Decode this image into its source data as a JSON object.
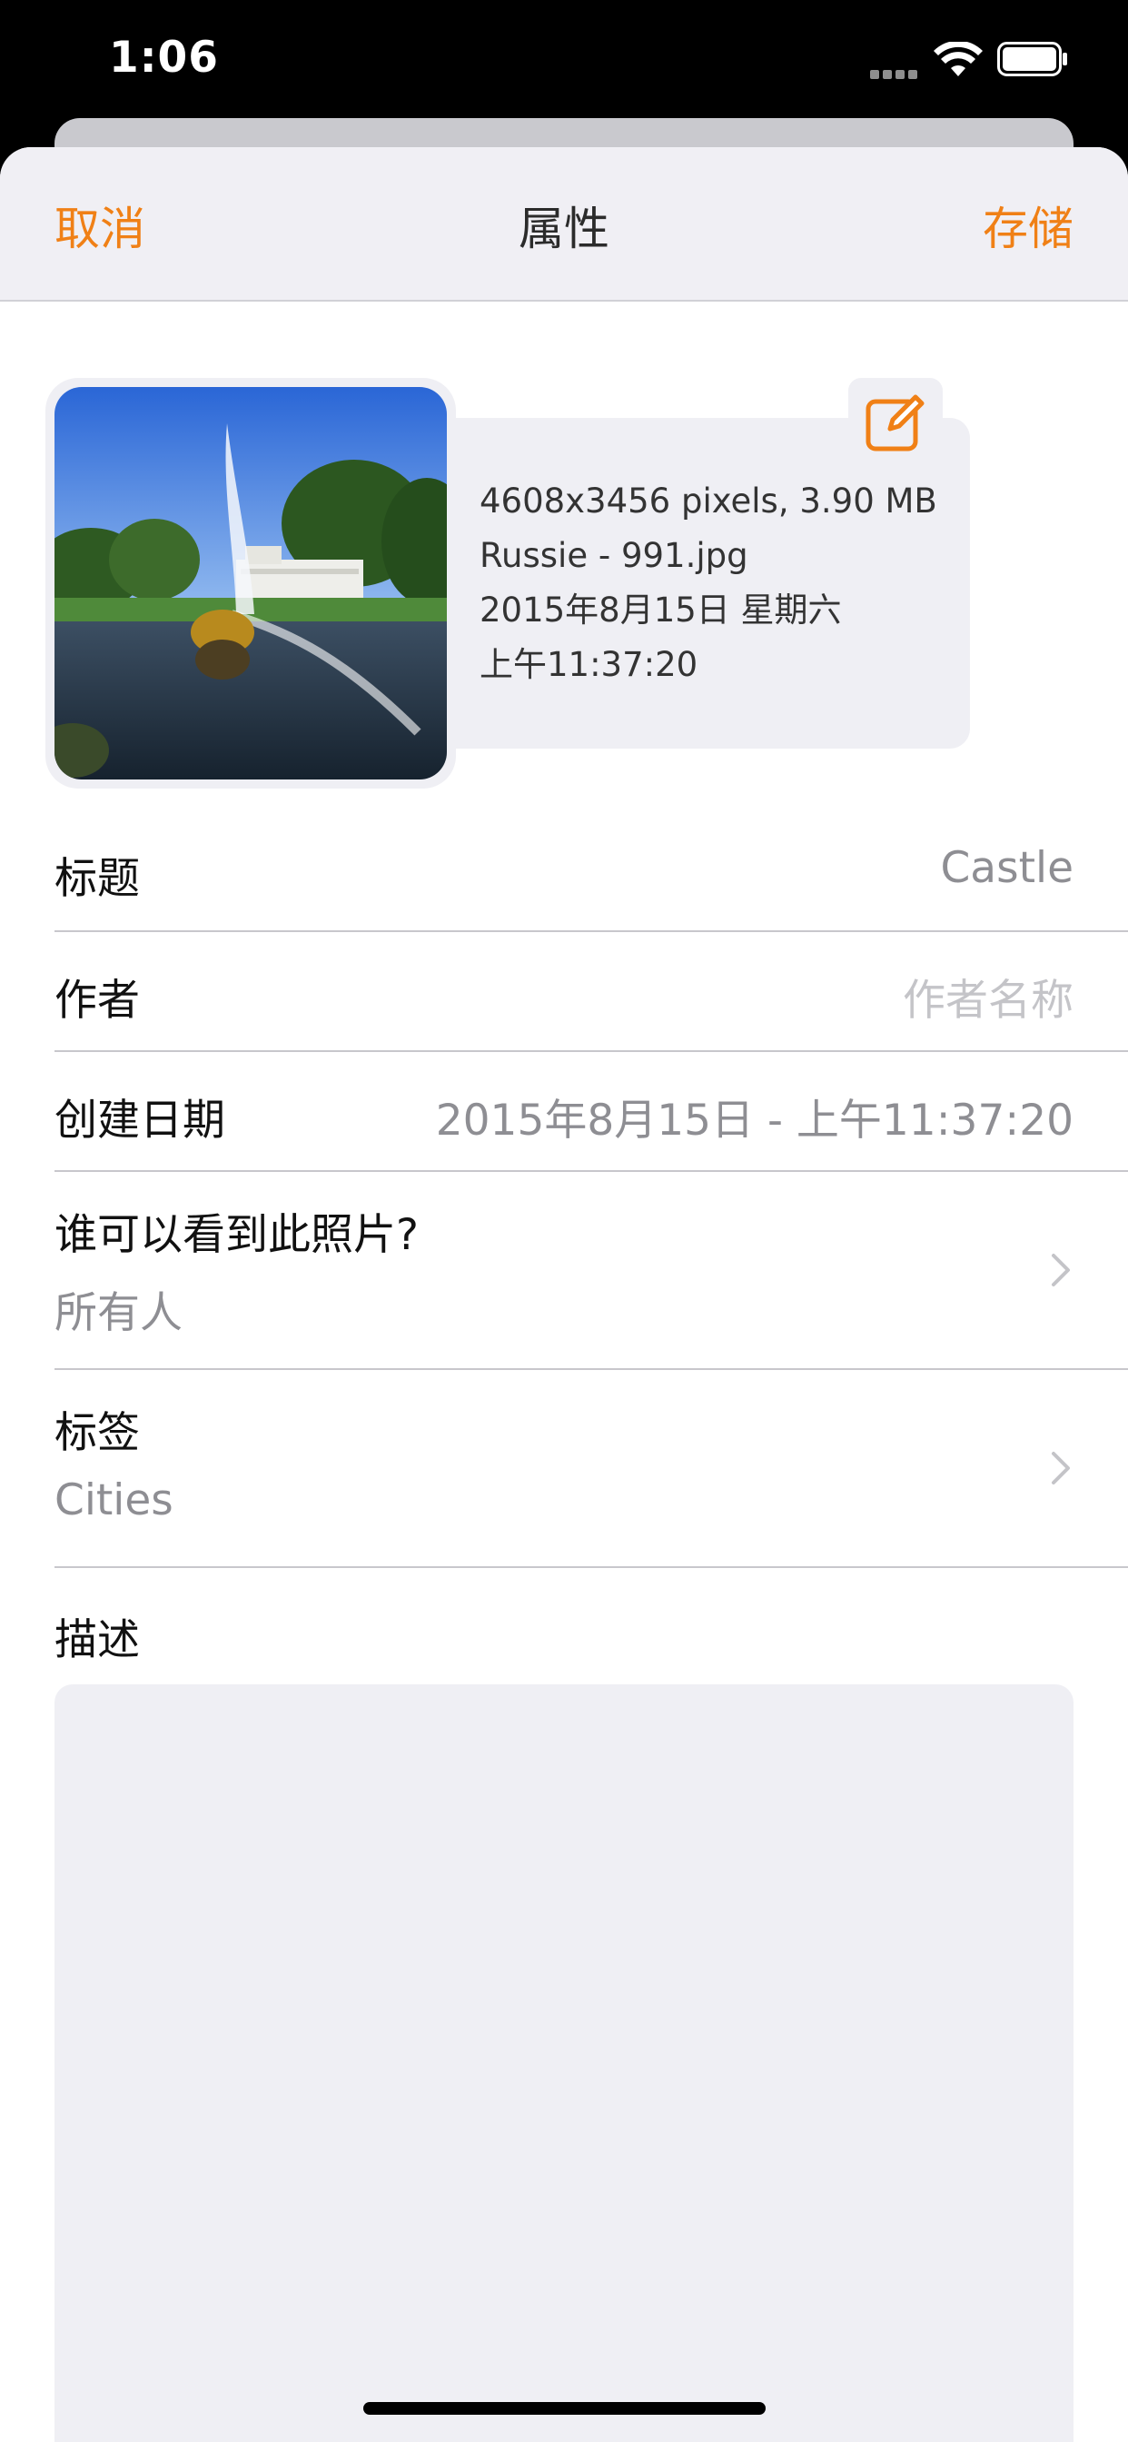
{
  "status_bar": {
    "time": "1:06"
  },
  "nav": {
    "cancel_label": "取消",
    "title": "属性",
    "save_label": "存储"
  },
  "photo_info": {
    "dimensions_size": "4608x3456 pixels, 3.90 MB",
    "filename": "Russie - 991.jpg",
    "date": "2015年8月15日 星期六",
    "time": "上午11:37:20"
  },
  "fields": {
    "title": {
      "label": "标题",
      "value": "Castle"
    },
    "author": {
      "label": "作者",
      "placeholder": "作者名称"
    },
    "created": {
      "label": "创建日期",
      "value": "2015年8月15日 - 上午11:37:20"
    },
    "visibility": {
      "label": "谁可以看到此照片?",
      "value": "所有人"
    },
    "tags": {
      "label": "标签",
      "value": "Cities"
    },
    "description": {
      "label": "描述"
    }
  },
  "colors": {
    "accent": "#f08016",
    "nav_background": "#f0eff4",
    "field_background": "#efeff4"
  },
  "icons": {
    "edit": "edit-square-icon",
    "chevron": "chevron-right-icon"
  }
}
